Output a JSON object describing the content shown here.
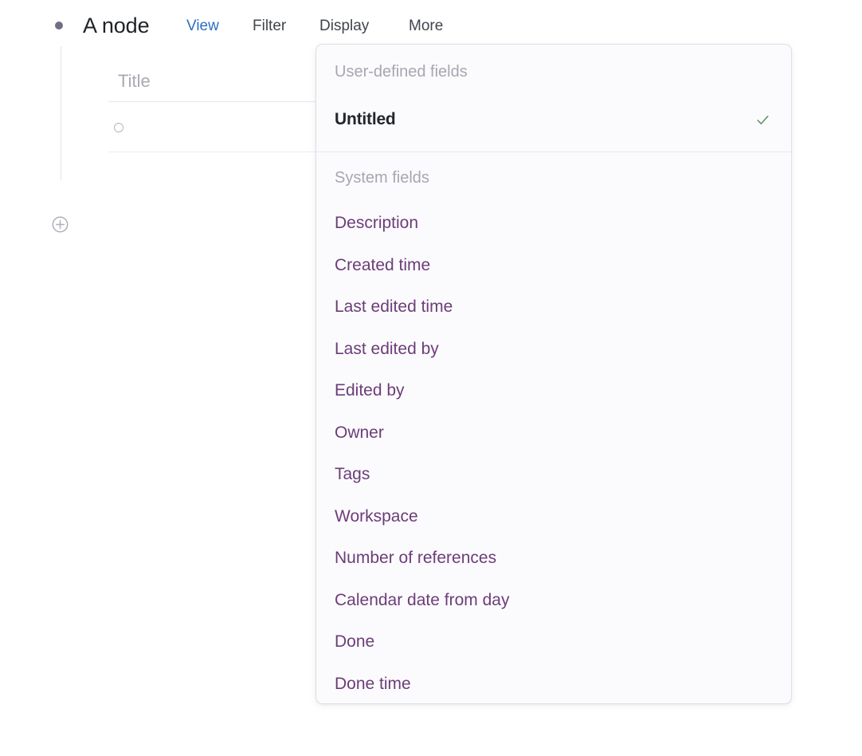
{
  "document": {
    "bullet_icon": "bullet-dot-icon",
    "node_title": "A node",
    "menu": [
      {
        "label": "View",
        "active": true
      },
      {
        "label": "Filter",
        "active": false
      },
      {
        "label": "Display",
        "active": false
      },
      {
        "label": "More",
        "active": false
      }
    ],
    "table": {
      "column_header": "Title",
      "row_toggle_icon": "circle-outline-icon"
    },
    "add_block_icon": "plus-circle-icon"
  },
  "dropdown": {
    "sections": [
      {
        "label": "User-defined fields",
        "items": [
          {
            "label": "Untitled",
            "checked": true
          }
        ]
      },
      {
        "label": "System fields",
        "items": [
          {
            "label": "Description",
            "checked": false
          },
          {
            "label": "Created time",
            "checked": false
          },
          {
            "label": "Last edited time",
            "checked": false
          },
          {
            "label": "Last edited by",
            "checked": false
          },
          {
            "label": "Edited by",
            "checked": false
          },
          {
            "label": "Owner",
            "checked": false
          },
          {
            "label": "Tags",
            "checked": false
          },
          {
            "label": "Workspace",
            "checked": false
          },
          {
            "label": "Number of references",
            "checked": false
          },
          {
            "label": "Calendar date from day",
            "checked": false
          },
          {
            "label": "Done",
            "checked": false
          },
          {
            "label": "Done time",
            "checked": false
          }
        ]
      }
    ],
    "check_icon": "check-icon"
  },
  "colors": {
    "accent_link": "#2c6fc4",
    "system_field_text": "#6c3d78",
    "check_green": "#5d8a66",
    "panel_bg": "#fbfbfd",
    "muted_label": "#a6a7b2"
  }
}
